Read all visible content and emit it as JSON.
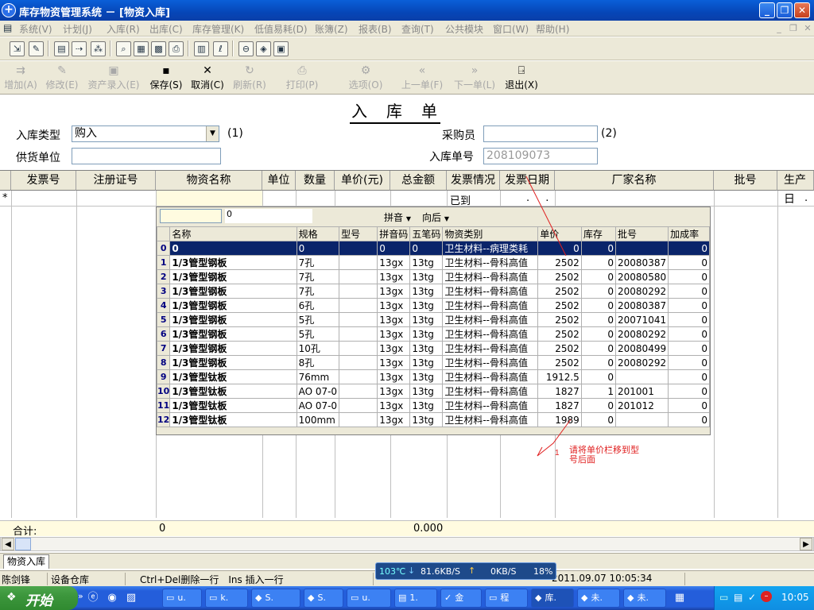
{
  "window": {
    "title": "库存物资管理系统 － [物资入库]",
    "minimize_glyph": "_",
    "maximize_glyph": "❐",
    "close_glyph": "✕"
  },
  "menu": {
    "items": [
      "系统(V)",
      "计划(J)",
      "入库(R)",
      "出库(C)",
      "库存管理(K)",
      "低值易耗(D)",
      "账簿(Z)",
      "报表(B)",
      "查询(T)",
      "公共模块",
      "窗口(W)",
      "帮助(H)"
    ]
  },
  "toolbar_icons": [
    "login-icon",
    "edit-icon",
    "document-icon",
    "export-icon",
    "tree-icon",
    "search-icon",
    "form-icon",
    "grid-icon",
    "print-icon",
    "folder-icon",
    "thermometer-icon",
    "stop-icon",
    "book-icon",
    "calc-icon"
  ],
  "actions": {
    "add": "增加(A)",
    "modify": "修改(E)",
    "asset_entry": "资产录入(E)",
    "save": "保存(S)",
    "cancel": "取消(C)",
    "refresh": "刷新(R)",
    "print": "打印(P)",
    "options": "选项(O)",
    "prev": "上一单(F)",
    "next": "下一单(L)",
    "exit": "退出(X)"
  },
  "form": {
    "title": "入　库　单",
    "type_label": "入库类型",
    "type_value": "购入",
    "type_note": "(1)",
    "supplier_label": "供货单位",
    "supplier_value": "",
    "buyer_label": "采购员",
    "buyer_value": "",
    "buyer_note": "(2)",
    "doc_no_label": "入库单号",
    "doc_no_value": "208109073"
  },
  "grid": {
    "columns": [
      "发票号",
      "注册证号",
      "物资名称",
      "单位",
      "数量",
      "单价(元)",
      "总金额",
      "发票情况",
      "发票日期",
      "厂家名称",
      "批号",
      "生产日"
    ],
    "new_row": {
      "marker": "*",
      "invoice_status": "已到",
      "invoice_date": ". .",
      "production_date": "."
    },
    "sum_label": "合计:",
    "sum_qty": "0",
    "sum_amount": "0.000"
  },
  "dropdown": {
    "search_value": "",
    "search_count": "0",
    "mode": "拼音",
    "direction": "向后",
    "columns": [
      "名称",
      "规格",
      "型号",
      "拼音码",
      "五笔码",
      "物资类别",
      "单价",
      "库存",
      "批号",
      "加成率"
    ],
    "rows": [
      {
        "idx": "0",
        "name": "0",
        "spec": "0",
        "model": "",
        "py": "0",
        "wb": "0",
        "category": "卫生材料--病理类耗",
        "price": "0",
        "stock": "0",
        "batch": "",
        "markup": "0"
      },
      {
        "idx": "1",
        "name": "1/3管型钢板",
        "spec": "7孔",
        "model": "",
        "py": "13gx",
        "wb": "13tg",
        "category": "卫生材料--骨科高值",
        "price": "2502",
        "stock": "0",
        "batch": "20080387",
        "markup": "0"
      },
      {
        "idx": "2",
        "name": "1/3管型钢板",
        "spec": "7孔",
        "model": "",
        "py": "13gx",
        "wb": "13tg",
        "category": "卫生材料--骨科高值",
        "price": "2502",
        "stock": "0",
        "batch": "20080580",
        "markup": "0"
      },
      {
        "idx": "3",
        "name": "1/3管型钢板",
        "spec": "7孔",
        "model": "",
        "py": "13gx",
        "wb": "13tg",
        "category": "卫生材料--骨科高值",
        "price": "2502",
        "stock": "0",
        "batch": "20080292",
        "markup": "0"
      },
      {
        "idx": "4",
        "name": "1/3管型钢板",
        "spec": "6孔",
        "model": "",
        "py": "13gx",
        "wb": "13tg",
        "category": "卫生材料--骨科高值",
        "price": "2502",
        "stock": "0",
        "batch": "20080387",
        "markup": "0"
      },
      {
        "idx": "5",
        "name": "1/3管型钢板",
        "spec": "5孔",
        "model": "",
        "py": "13gx",
        "wb": "13tg",
        "category": "卫生材料--骨科高值",
        "price": "2502",
        "stock": "0",
        "batch": "20071041",
        "markup": "0"
      },
      {
        "idx": "6",
        "name": "1/3管型钢板",
        "spec": "5孔",
        "model": "",
        "py": "13gx",
        "wb": "13tg",
        "category": "卫生材料--骨科高值",
        "price": "2502",
        "stock": "0",
        "batch": "20080292",
        "markup": "0"
      },
      {
        "idx": "7",
        "name": "1/3管型钢板",
        "spec": "10孔",
        "model": "",
        "py": "13gx",
        "wb": "13tg",
        "category": "卫生材料--骨科高值",
        "price": "2502",
        "stock": "0",
        "batch": "20080499",
        "markup": "0"
      },
      {
        "idx": "8",
        "name": "1/3管型钢板",
        "spec": "8孔",
        "model": "",
        "py": "13gx",
        "wb": "13tg",
        "category": "卫生材料--骨科高值",
        "price": "2502",
        "stock": "0",
        "batch": "20080292",
        "markup": "0"
      },
      {
        "idx": "9",
        "name": "1/3管型钛板",
        "spec": "76mm",
        "model": "",
        "py": "13gx",
        "wb": "13tg",
        "category": "卫生材料--骨科高值",
        "price": "1912.5",
        "stock": "0",
        "batch": "",
        "markup": "0"
      },
      {
        "idx": "10",
        "name": "1/3管型钛板",
        "spec": "AO 07-0",
        "model": "",
        "py": "13gx",
        "wb": "13tg",
        "category": "卫生材料--骨科高值",
        "price": "1827",
        "stock": "1",
        "batch": "201001",
        "markup": "0"
      },
      {
        "idx": "11",
        "name": "1/3管型钛板",
        "spec": "AO 07-0",
        "model": "",
        "py": "13gx",
        "wb": "13tg",
        "category": "卫生材料--骨科高值",
        "price": "1827",
        "stock": "0",
        "batch": "201012",
        "markup": "0"
      },
      {
        "idx": "12",
        "name": "1/3管型钛板",
        "spec": "100mm",
        "model": "",
        "py": "13gx",
        "wb": "13tg",
        "category": "卫生材料--骨科高值",
        "price": "1989",
        "stock": "0",
        "batch": "",
        "markup": "0"
      }
    ]
  },
  "annotation": {
    "number": "1",
    "note_line1": "请将单价栏移到型",
    "note_line2": "号后面",
    "color": "#e02020"
  },
  "tab": {
    "label": "物资入库"
  },
  "status": {
    "user": "陈剑锋",
    "warehouse": "设备仓库",
    "hint": "Ctrl+Del删除一行　Ins 插入一行",
    "datetime": "2011.09.07 10:05:34"
  },
  "netmeter": {
    "temp": "103℃",
    "down": "81.6KB/S",
    "up": "0KB/S",
    "cpu": "18%"
  },
  "taskbar": {
    "start": "开始",
    "tasks": [
      "u.",
      "k.",
      "S.",
      "S.",
      "u.",
      "1.",
      "金",
      "程",
      "库.",
      "未.",
      "未."
    ],
    "clock": "10:05"
  }
}
